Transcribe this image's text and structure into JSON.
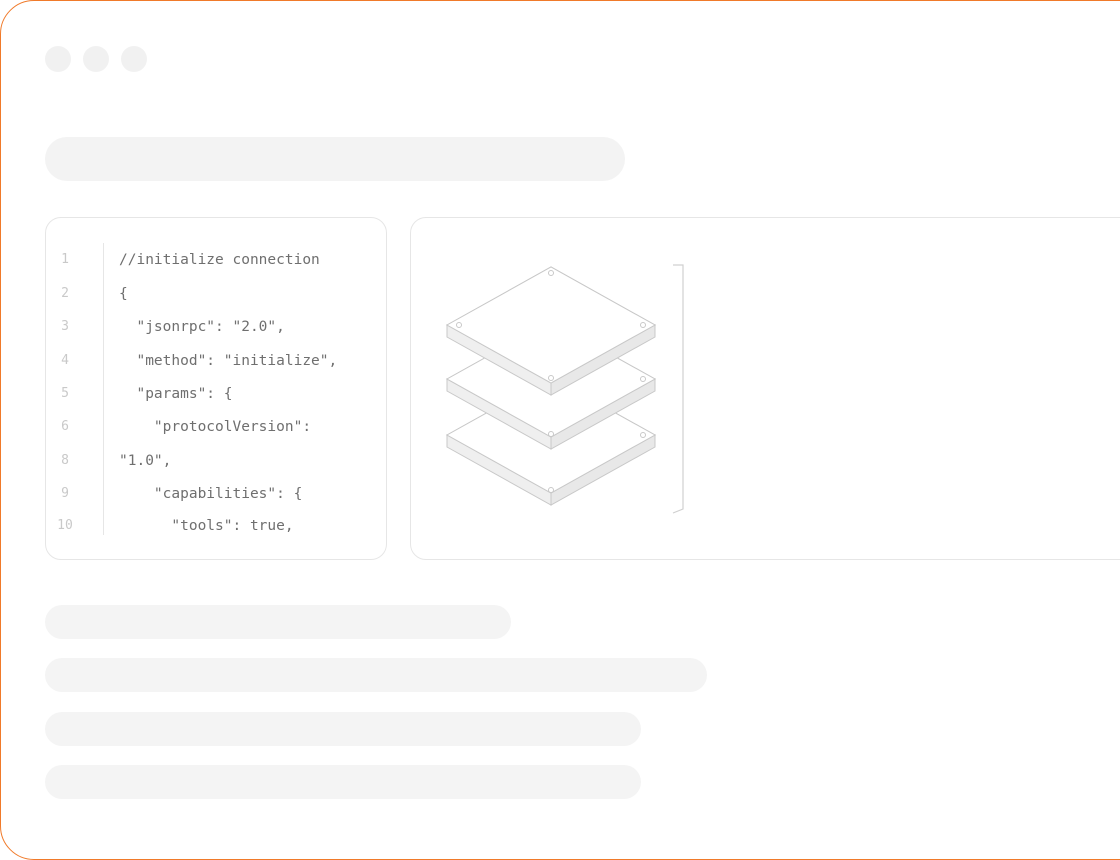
{
  "window": {
    "border_color": "#f07a2a"
  },
  "code": {
    "lines": [
      {
        "n": "1",
        "text": "//initialize connection"
      },
      {
        "n": "2",
        "text": "{"
      },
      {
        "n": "3",
        "text": "  \"jsonrpc\": \"2.0\","
      },
      {
        "n": "4",
        "text": "  \"method\": \"initialize\","
      },
      {
        "n": "5",
        "text": "  \"params\": {"
      },
      {
        "n": "6",
        "text": "    \"protocolVersion\":"
      },
      {
        "n": "8",
        "text": "\"1.0\","
      },
      {
        "n": "9",
        "text": "    \"capabilities\": {"
      },
      {
        "n": "10",
        "text": "      \"tools\": true,"
      }
    ]
  },
  "diagram": {
    "icon": "stacked-layers-icon"
  }
}
